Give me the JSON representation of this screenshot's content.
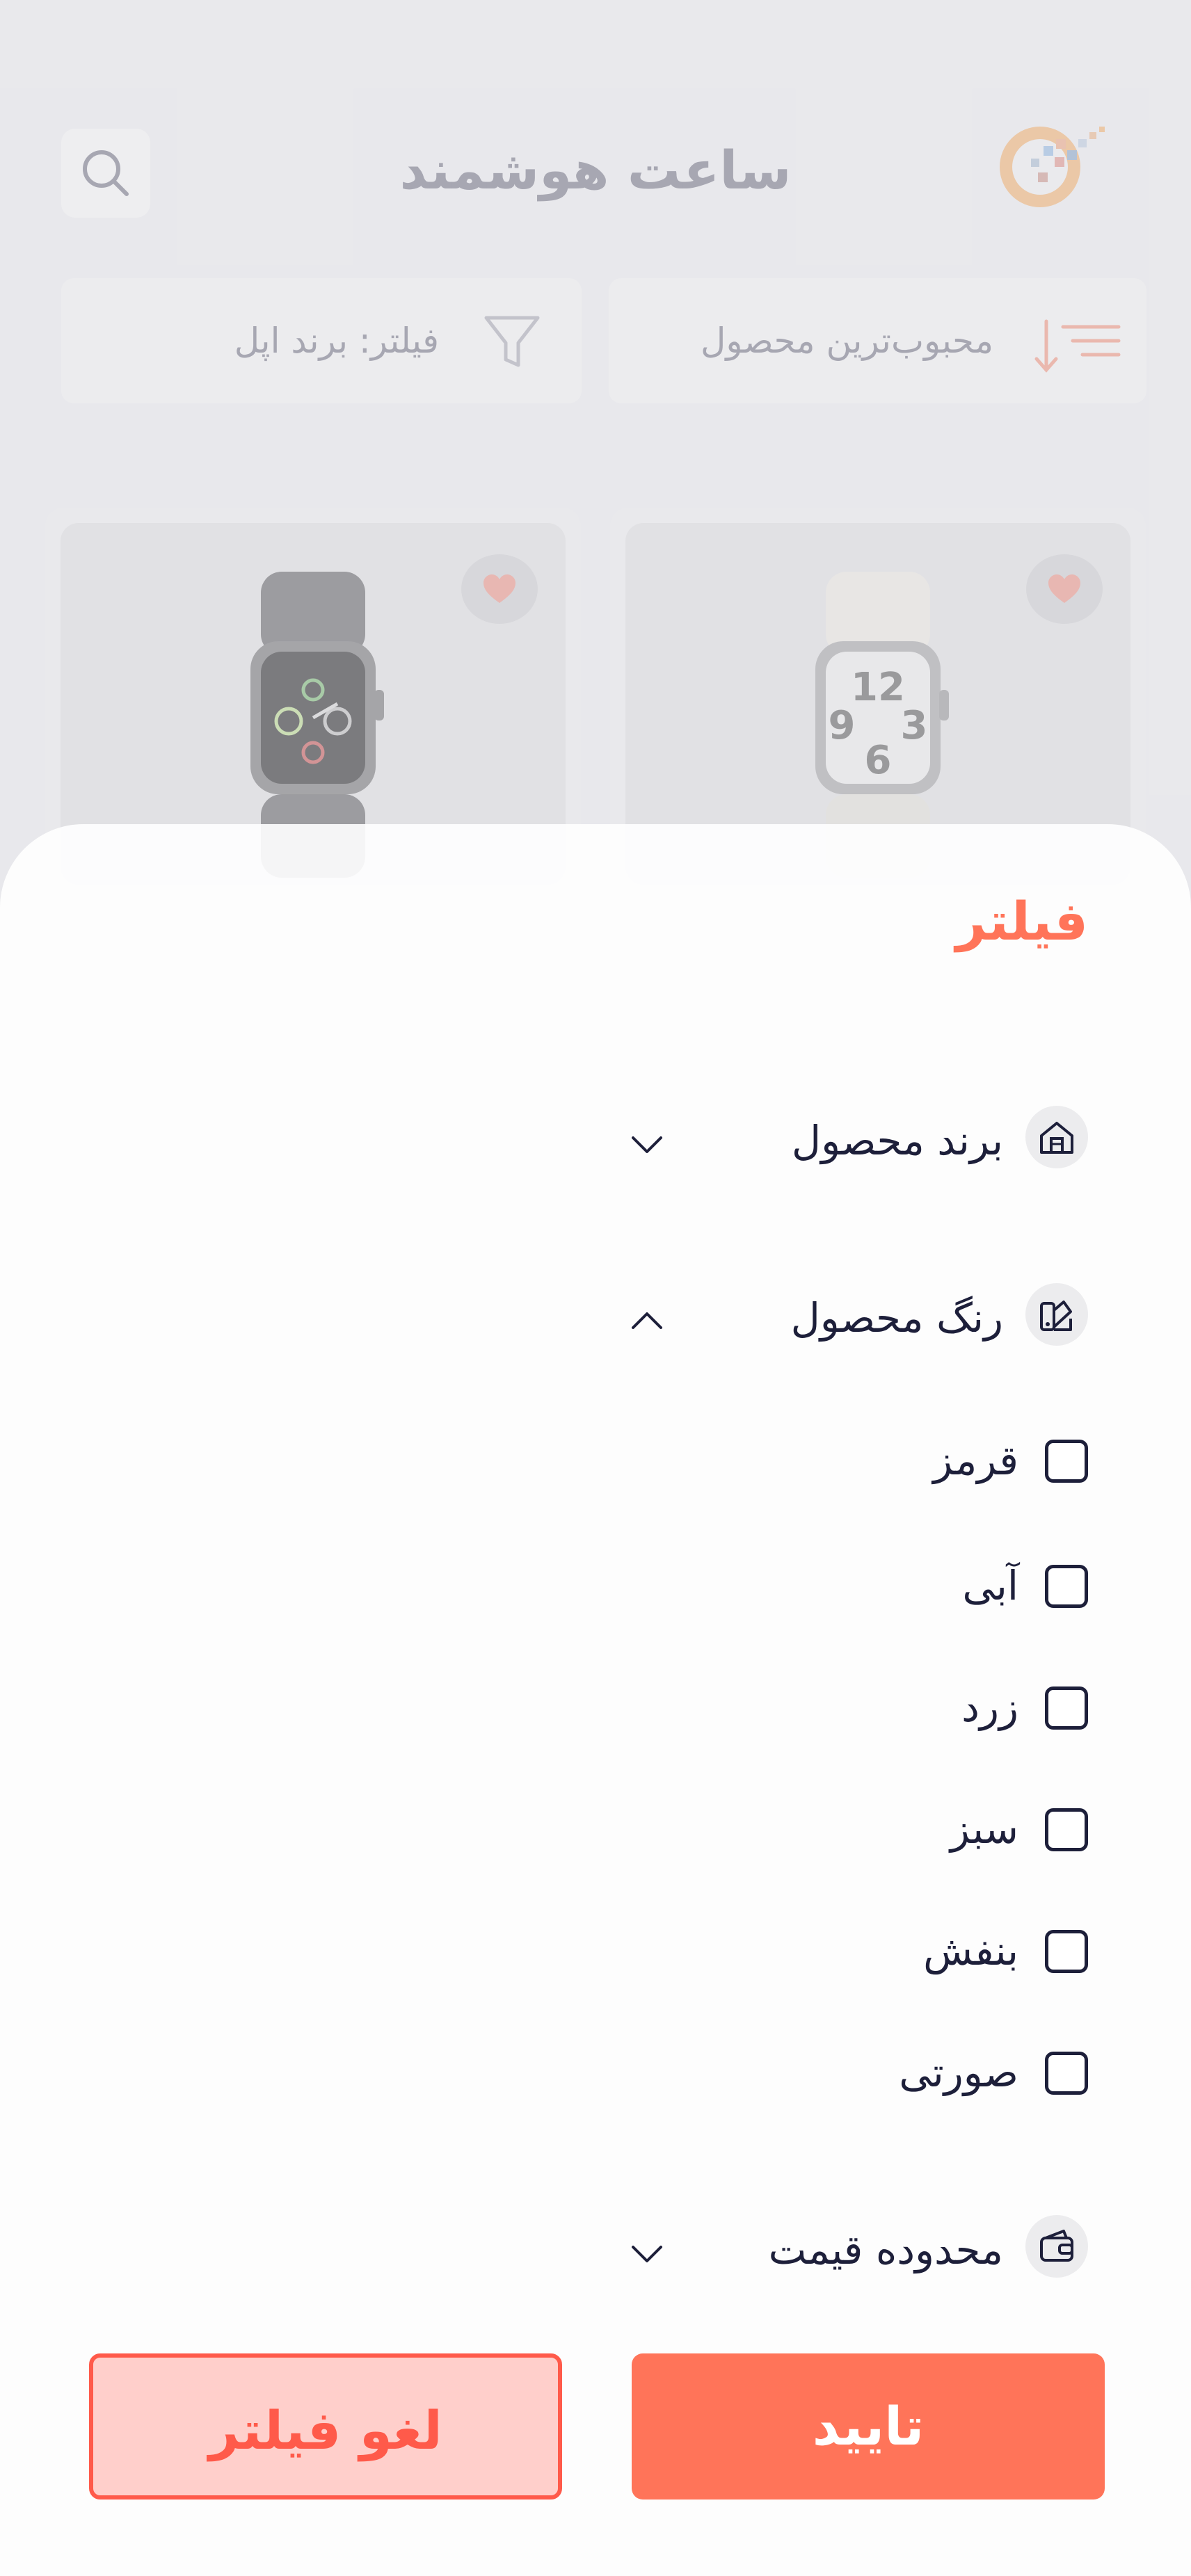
{
  "header": {
    "title": "ساعت هوشمند"
  },
  "toolbar": {
    "sort_label": "محبوب‌ترین محصول",
    "filter_label": "فیلتر: برند اپل"
  },
  "colors": {
    "accent": "#ff7459",
    "danger": "#ff5a4a",
    "text_dark": "#1d1f3a",
    "muted": "#8e8e9c"
  },
  "filter_sheet": {
    "title": "فیلتر",
    "sections": [
      {
        "label": "برند محصول",
        "icon": "brand-icon",
        "expanded": false
      },
      {
        "label": "رنگ محصول",
        "icon": "palette-icon",
        "expanded": true
      },
      {
        "label": "محدوده قیمت",
        "icon": "wallet-icon",
        "expanded": false
      }
    ],
    "color_options": [
      {
        "label": "قرمز",
        "checked": false
      },
      {
        "label": "آبی",
        "checked": false
      },
      {
        "label": "زرد",
        "checked": false
      },
      {
        "label": "سبز",
        "checked": false
      },
      {
        "label": "بنفش",
        "checked": false
      },
      {
        "label": "صورتی",
        "checked": false
      }
    ],
    "confirm_label": "تایید",
    "clear_label": "لغو فیلتر"
  }
}
